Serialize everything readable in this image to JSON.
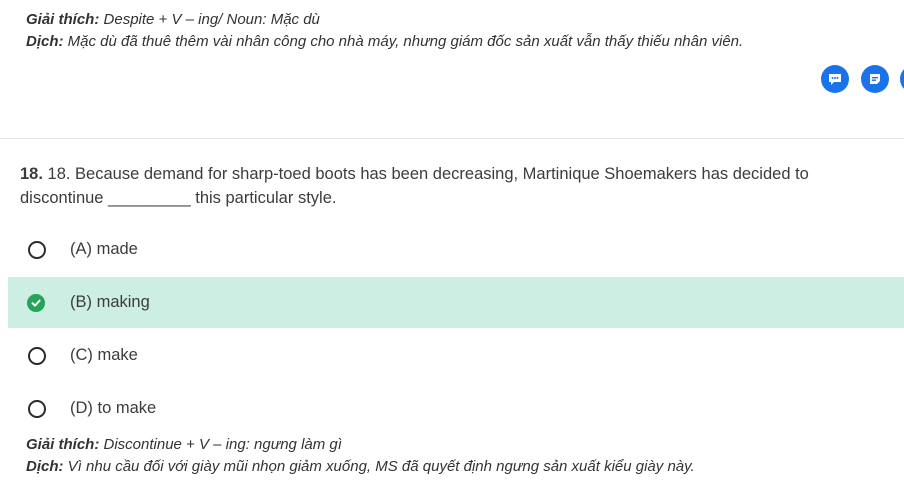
{
  "prev_explanation": {
    "label1": "Giải thích:",
    "text1": "Despite + V – ing/ Noun: Mặc dù",
    "label2": "Dịch:",
    "text2": "Mặc dù đã thuê thêm vài nhân công cho nhà máy, nhưng giám đốc sản xuất vẫn thấy thiếu nhân viên."
  },
  "icons": {
    "comment": "comment-icon",
    "note": "note-icon",
    "color": "#1a73e8"
  },
  "question": {
    "number": "18.",
    "text": "18. Because demand for sharp-toed boots has been decreasing, Martinique Shoemakers has decided to discontinue _________ this particular style."
  },
  "options": [
    {
      "label": "(A) made",
      "state": "unselected"
    },
    {
      "label": "(B) making",
      "state": "correct"
    },
    {
      "label": "(C) make",
      "state": "unselected"
    },
    {
      "label": "(D) to make",
      "state": "unselected"
    }
  ],
  "explanation": {
    "label1": "Giải thích:",
    "text1": "Discontinue + V – ing: ngưng làm gì",
    "label2": "Dịch:",
    "text2": "Vì nhu cầu đối với giày mũi nhọn giảm xuống, MS đã quyết định ngưng sản xuất kiểu giày này."
  },
  "colors": {
    "correct_bg": "#cdeee3",
    "check": "#25a35a"
  }
}
